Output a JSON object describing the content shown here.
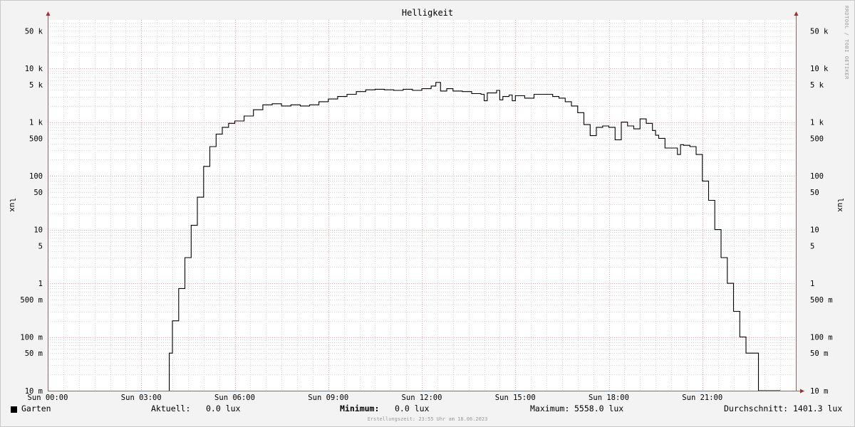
{
  "chart_data": {
    "type": "line",
    "title": "Helligkeit",
    "ylabel": "lux",
    "ylabel_right": "lux",
    "y_scale": "log",
    "ylim": [
      0.01,
      80000
    ],
    "xlim": [
      0,
      24
    ],
    "x_unit": "hours",
    "y_ticks": [
      {
        "value": 50000,
        "label": "50 k"
      },
      {
        "value": 10000,
        "label": "10 k"
      },
      {
        "value": 5000,
        "label": "5 k"
      },
      {
        "value": 1000,
        "label": "1 k"
      },
      {
        "value": 500,
        "label": "500"
      },
      {
        "value": 100,
        "label": "100"
      },
      {
        "value": 50,
        "label": "50"
      },
      {
        "value": 10,
        "label": "10"
      },
      {
        "value": 5,
        "label": "5"
      },
      {
        "value": 1,
        "label": "1"
      },
      {
        "value": 0.5,
        "label": "500 m"
      },
      {
        "value": 0.1,
        "label": "100 m"
      },
      {
        "value": 0.05,
        "label": "50 m"
      },
      {
        "value": 0.01,
        "label": "10 m"
      }
    ],
    "x_ticks": [
      {
        "value": 0,
        "label": "Sun 00:00"
      },
      {
        "value": 3,
        "label": "Sun 03:00"
      },
      {
        "value": 6,
        "label": "Sun 06:00"
      },
      {
        "value": 9,
        "label": "Sun 09:00"
      },
      {
        "value": 12,
        "label": "Sun 12:00"
      },
      {
        "value": 15,
        "label": "Sun 15:00"
      },
      {
        "value": 18,
        "label": "Sun 18:00"
      },
      {
        "value": 21,
        "label": "Sun 21:00"
      }
    ],
    "grid": true,
    "watermark": "RRDTOOL / TOBI OETIKER",
    "series": [
      {
        "name": "Garten",
        "color": "#000000",
        "x": [
          3.9,
          4.0,
          4.2,
          4.4,
          4.6,
          4.8,
          5.0,
          5.2,
          5.4,
          5.6,
          5.8,
          6.0,
          6.3,
          6.6,
          6.9,
          7.2,
          7.5,
          7.8,
          8.1,
          8.4,
          8.7,
          9.0,
          9.3,
          9.6,
          9.9,
          10.2,
          10.5,
          10.8,
          11.1,
          11.4,
          11.7,
          12.0,
          12.3,
          12.45,
          12.6,
          12.8,
          13.0,
          13.3,
          13.6,
          13.9,
          14.0,
          14.1,
          14.4,
          14.5,
          14.6,
          14.8,
          14.9,
          15.0,
          15.3,
          15.6,
          15.9,
          16.2,
          16.4,
          16.6,
          16.8,
          17.0,
          17.2,
          17.4,
          17.6,
          17.8,
          18.0,
          18.2,
          18.4,
          18.6,
          18.8,
          19.0,
          19.2,
          19.4,
          19.5,
          19.6,
          19.8,
          20.0,
          20.2,
          20.3,
          20.4,
          20.6,
          20.8,
          21.0,
          21.2,
          21.4,
          21.6,
          21.8,
          22.0,
          22.2,
          22.4,
          22.6,
          22.8,
          22.9,
          23.0,
          23.2,
          23.5
        ],
        "y": [
          0.05,
          0.2,
          0.8,
          3,
          12,
          40,
          150,
          350,
          600,
          800,
          950,
          1050,
          1300,
          1700,
          2100,
          2200,
          2000,
          2100,
          2000,
          2100,
          2400,
          2700,
          3000,
          3300,
          3700,
          4000,
          4100,
          4000,
          3900,
          4100,
          3900,
          4200,
          4700,
          5500,
          3800,
          4200,
          3800,
          3700,
          3400,
          3300,
          2500,
          3500,
          3900,
          2600,
          3000,
          3200,
          2500,
          3100,
          2800,
          3300,
          3300,
          3000,
          2800,
          2400,
          2000,
          1500,
          900,
          560,
          800,
          850,
          800,
          470,
          1000,
          850,
          750,
          1150,
          950,
          700,
          570,
          500,
          330,
          330,
          250,
          380,
          370,
          350,
          250,
          80,
          35,
          10,
          3,
          1,
          0.3,
          0.1,
          0.05,
          0.05,
          0.01,
          0.01,
          0.01,
          0.01,
          0.01
        ]
      }
    ]
  },
  "legend": {
    "series_label": "Garten",
    "current_label": "Aktuell:",
    "current_value": "0.0 lux",
    "min_label": "Minimum:",
    "min_value": "0.0 lux",
    "max_label": "Maximum:",
    "max_value": "5558.0 lux",
    "avg_label": "Durchschnitt:",
    "avg_value": "1401.3 lux"
  },
  "footer": "Erstellungszeit: 23:55 Uhr am 18.06.2023",
  "colors": {
    "background": "#f3f3f3",
    "plot_background": "#ffffff",
    "major_grid": "#e8a0a0",
    "minor_grid": "#d6d6d6",
    "axis": "#a06060",
    "line": "#000000"
  }
}
